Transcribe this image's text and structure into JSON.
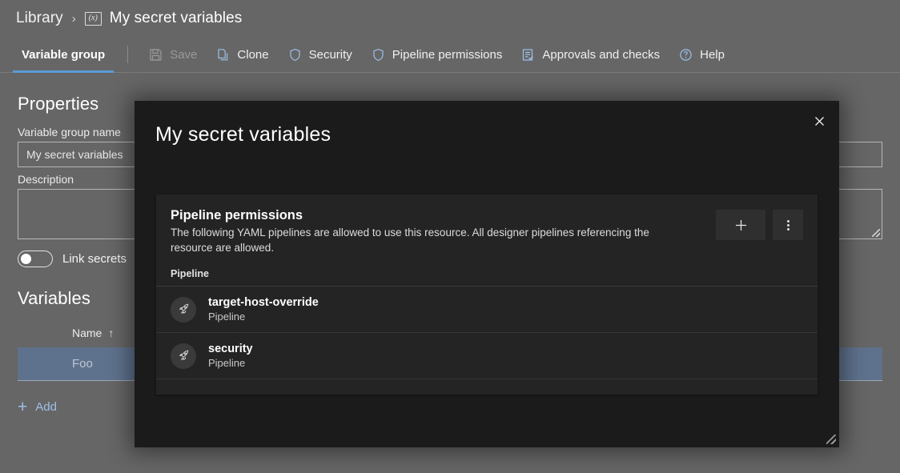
{
  "breadcrumb": {
    "root_label": "Library",
    "separator": "›",
    "icon_name": "variable-group-icon",
    "icon_text": "(x)",
    "current_label": "My secret variables"
  },
  "toolbar": {
    "tab_label": "Variable group",
    "items": [
      {
        "label": "Save",
        "icon": "save-icon",
        "disabled": true
      },
      {
        "label": "Clone",
        "icon": "clone-icon",
        "disabled": false
      },
      {
        "label": "Security",
        "icon": "shield-icon",
        "disabled": false
      },
      {
        "label": "Pipeline permissions",
        "icon": "shield-icon",
        "disabled": false
      },
      {
        "label": "Approvals and checks",
        "icon": "checklist-icon",
        "disabled": false
      },
      {
        "label": "Help",
        "icon": "help-circle-icon",
        "disabled": false
      }
    ]
  },
  "properties": {
    "heading": "Properties",
    "name_label": "Variable group name",
    "name_value": "My secret variables",
    "description_label": "Description",
    "description_value": "",
    "link_secrets_label": "Link secrets",
    "link_secrets_on": false
  },
  "variables": {
    "heading": "Variables",
    "columns": [
      "Name"
    ],
    "sort_indicator": "↑",
    "rows": [
      {
        "name": "Foo",
        "selected": true
      }
    ],
    "add_label": "Add",
    "add_icon": "plus-icon"
  },
  "modal": {
    "title": "My secret variables",
    "close_icon": "close-icon",
    "resize_icon": "resize-grip-icon",
    "card": {
      "title": "Pipeline permissions",
      "description": "The following YAML pipelines are allowed to use this resource. All designer pipelines referencing the resource are allowed.",
      "add_icon": "plus-icon",
      "more_icon": "kebab-menu-icon",
      "column_header": "Pipeline",
      "items": [
        {
          "name": "target-host-override",
          "subtitle": "Pipeline",
          "icon": "rocket-icon"
        },
        {
          "name": "security",
          "subtitle": "Pipeline",
          "icon": "rocket-icon"
        }
      ]
    }
  },
  "colors": {
    "page_bg": "#666666",
    "modal_bg": "#1b1b1b",
    "card_bg": "#242424",
    "accent_blue": "#5b9bd5",
    "link_blue": "#9cc0e8",
    "row_selected": "#5f728d"
  }
}
